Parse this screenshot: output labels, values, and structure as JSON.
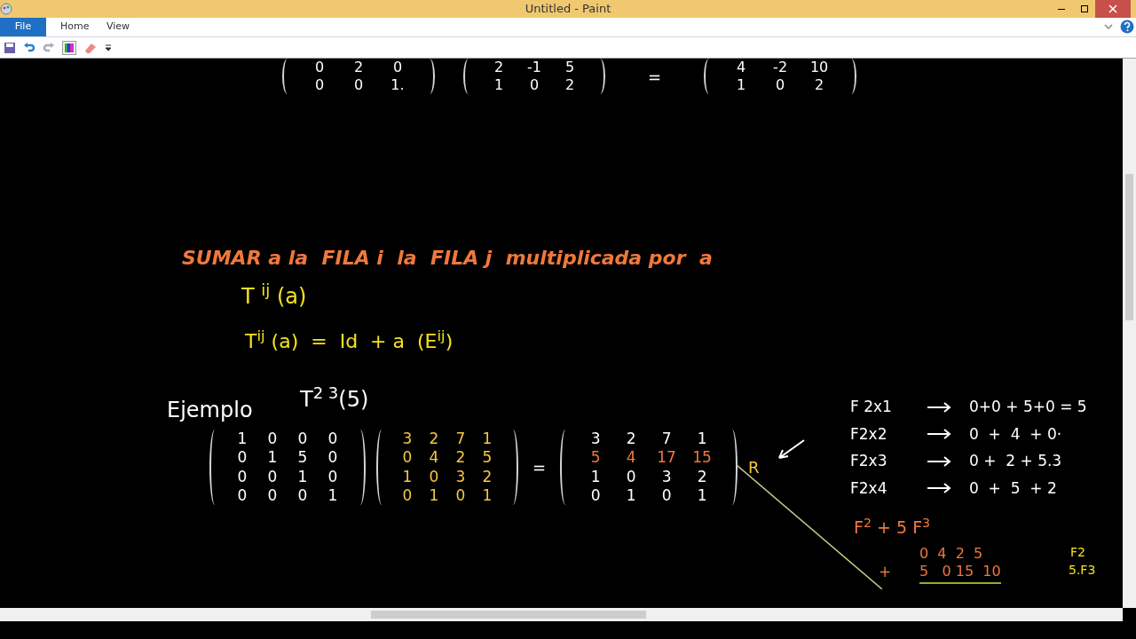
{
  "window": {
    "title": "Untitled - Paint"
  },
  "ribbon_tabs": [
    {
      "label": "File",
      "selected": true
    },
    {
      "label": "Home",
      "selected": false
    },
    {
      "label": "View",
      "selected": false
    }
  ],
  "top_row": {
    "matrices": [
      {
        "rows": [
          {
            "color": "#ffffff",
            "cells": [
              "0",
              "2",
              "0"
            ]
          },
          {
            "color": "#ffffff",
            "cells": [
              "0",
              "0",
              "1."
            ]
          }
        ]
      },
      {
        "rows": [
          {
            "color": "#ffffff",
            "cells": [
              "2",
              "-1",
              "5"
            ]
          },
          {
            "color": "#ffffff",
            "cells": [
              "1",
              "0",
              "2"
            ]
          }
        ]
      },
      {
        "rows": [
          {
            "color": "#ffffff",
            "cells": [
              "4",
              "-2",
              "10"
            ]
          },
          {
            "color": "#ffffff",
            "cells": [
              "1",
              "0",
              "2"
            ]
          }
        ]
      }
    ],
    "equals": "="
  },
  "heading": "SUMAR a la  FILA i  la  FILA j  multiplicada por  a",
  "formulas": [
    "T $^{ij}$ (a)",
    "T$^{ij}$ (a)  =  Id  + a  (E$^{ij}$)"
  ],
  "example": {
    "label": "Ejemplo",
    "operator": "T$^{2 3}$(5)",
    "matrices": [
      {
        "rows": [
          {
            "color": "#ffffff",
            "cells": [
              "1",
              "0",
              "0",
              "0"
            ]
          },
          {
            "color": "#ffffff",
            "cells": [
              "0",
              "1",
              "5",
              "0"
            ]
          },
          {
            "color": "#ffffff",
            "cells": [
              "0",
              "0",
              "1",
              "0"
            ]
          },
          {
            "color": "#ffffff",
            "cells": [
              "0",
              "0",
              "0",
              "1"
            ]
          }
        ]
      },
      {
        "rows": [
          {
            "color": "#f5c842",
            "cells": [
              "3",
              "2",
              "7",
              "1"
            ]
          },
          {
            "color": "#f5c842",
            "cells": [
              "0",
              "4",
              "2",
              "5"
            ]
          },
          {
            "color": "#f5c842",
            "cells": [
              "1",
              "0",
              "3",
              "2"
            ]
          },
          {
            "color": "#f5c842",
            "cells": [
              "0",
              "1",
              "0",
              "1"
            ]
          }
        ]
      },
      {
        "rows": [
          {
            "color": "#ffffff",
            "cells": [
              "3",
              "2",
              "7",
              "1"
            ]
          },
          {
            "color": "#f0783c",
            "cells": [
              "5",
              "4",
              "17",
              "15"
            ]
          },
          {
            "color": "#ffffff",
            "cells": [
              "1",
              "0",
              "3",
              "2"
            ]
          },
          {
            "color": "#ffffff",
            "cells": [
              "0",
              "1",
              "0",
              "1"
            ]
          }
        ]
      }
    ],
    "equals": "=",
    "mark": "R"
  },
  "notes": {
    "lines": [
      {
        "left": "F 2x1",
        "right": "0+0 + 5+0 = 5"
      },
      {
        "left": "F2x2",
        "right": "0  +  4  + 0·"
      },
      {
        "left": "F2x3",
        "right": "0 +  2 + 5.3"
      },
      {
        "left": "F2x4",
        "right": "0  +  5  + 2"
      }
    ],
    "sum": "F$^{2}$ + 5 F$^{3}$",
    "row_a": "0  4  2  5",
    "row_b": "5   0 15  10",
    "plus": "+",
    "label_a": "F2",
    "label_b": "5.F3"
  }
}
